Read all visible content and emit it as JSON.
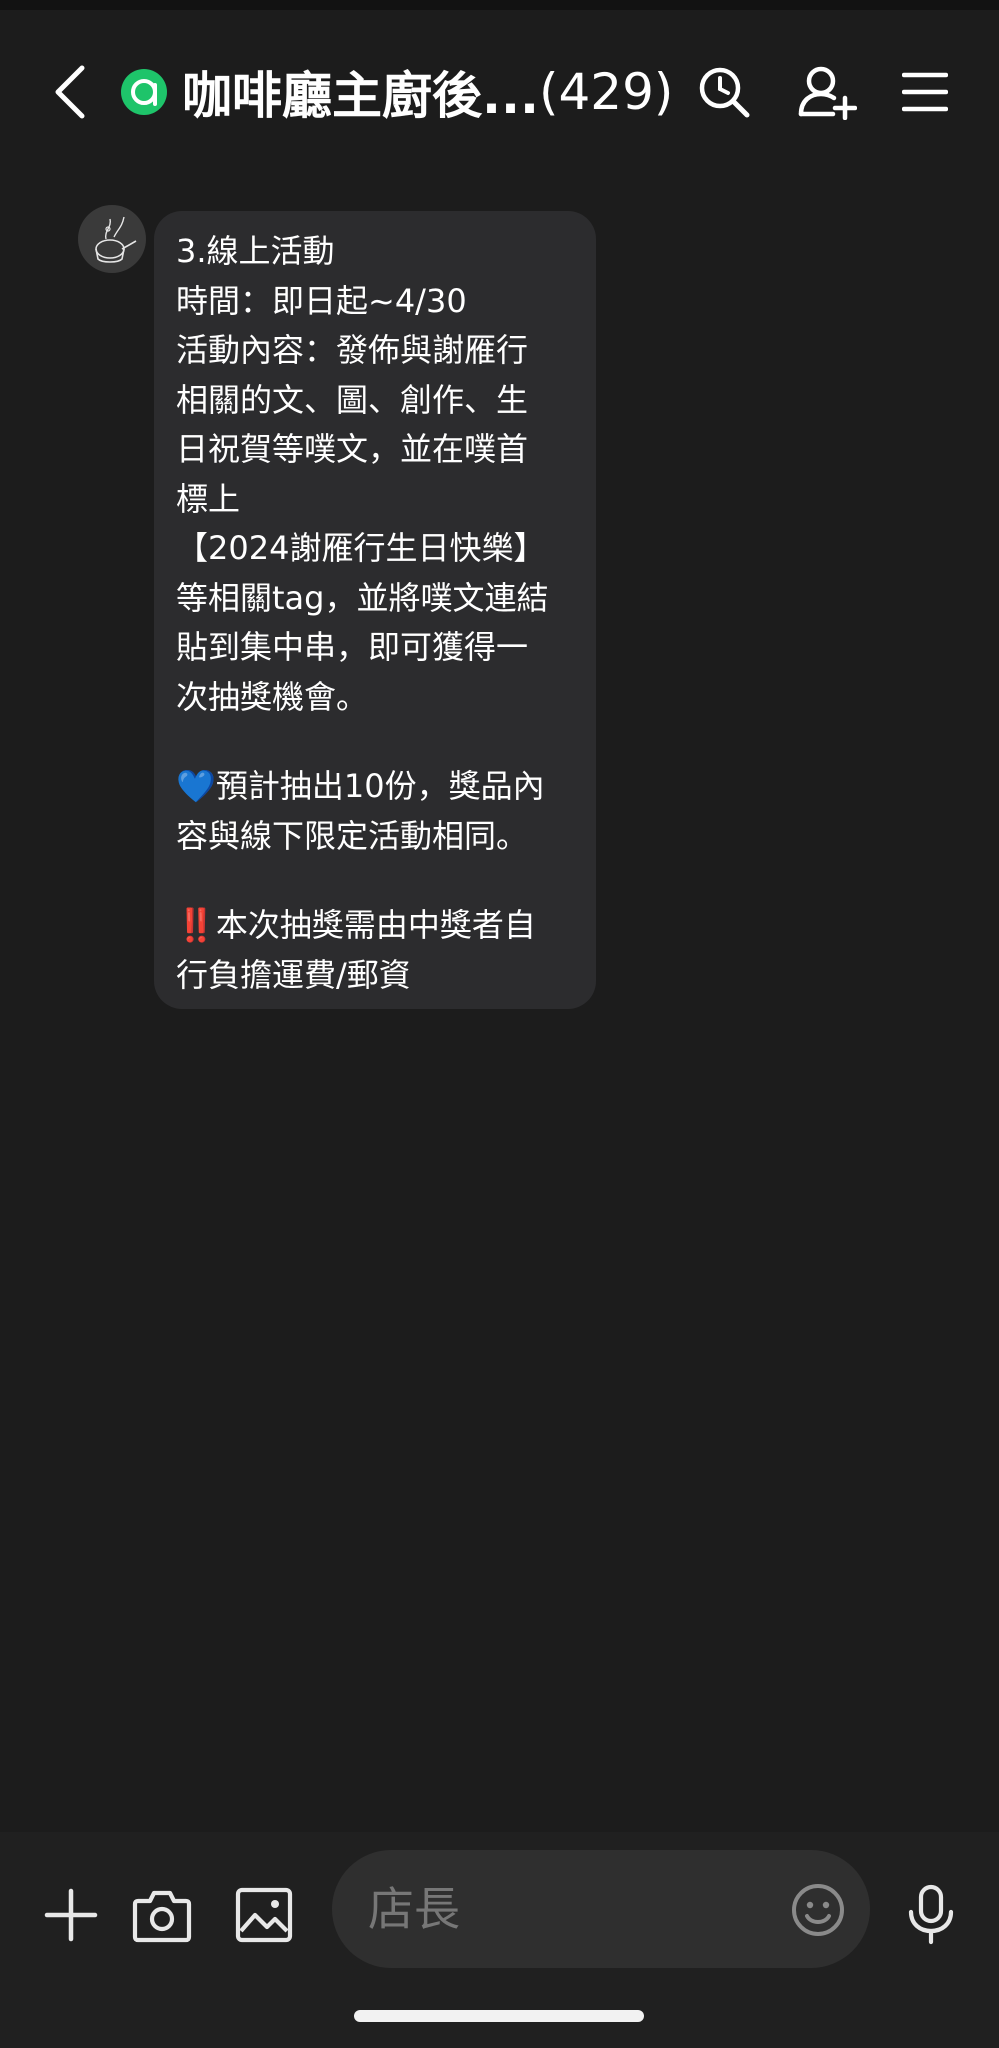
{
  "header": {
    "title": "咖啡廳主廚後...",
    "member_count": "(429)",
    "badge_letter": "a",
    "icons": {
      "back": "chevron-left-icon",
      "search": "search-icon",
      "add_friend": "add-person-icon",
      "menu": "hamburger-menu-icon"
    }
  },
  "message": {
    "sender_avatar_icon": "cooking-pot-avatar-icon",
    "lines": [
      "3.線上活動",
      "時間：即日起~4/30",
      "活動內容：發佈與謝雁行",
      "相關的文、圖、創作、生",
      "日祝賀等噗文，並在噗首",
      "標上",
      "【2024謝雁行生日快樂】",
      "等相關tag，並將噗文連結",
      "貼到集中串，即可獲得一",
      "次抽獎機會。"
    ],
    "prize_lines": [
      "預計抽出10份，獎品內",
      "容與線下限定活動相同。"
    ],
    "prize_emoji": "💙",
    "warning_lines": [
      "本次抽獎需由中獎者自",
      "行負擔運費/郵資"
    ],
    "warning_emoji": "‼️"
  },
  "composer": {
    "placeholder": "店長",
    "icons": {
      "plus": "plus-icon",
      "camera": "camera-icon",
      "gallery": "image-icon",
      "emoji": "smiley-icon",
      "mic": "microphone-icon"
    }
  },
  "colors": {
    "background": "#1c1c1c",
    "bubble": "#2c2c2e",
    "badge_green": "#1ec46a",
    "bottom_bar": "#202020",
    "input_bg": "#2f2f2f"
  }
}
